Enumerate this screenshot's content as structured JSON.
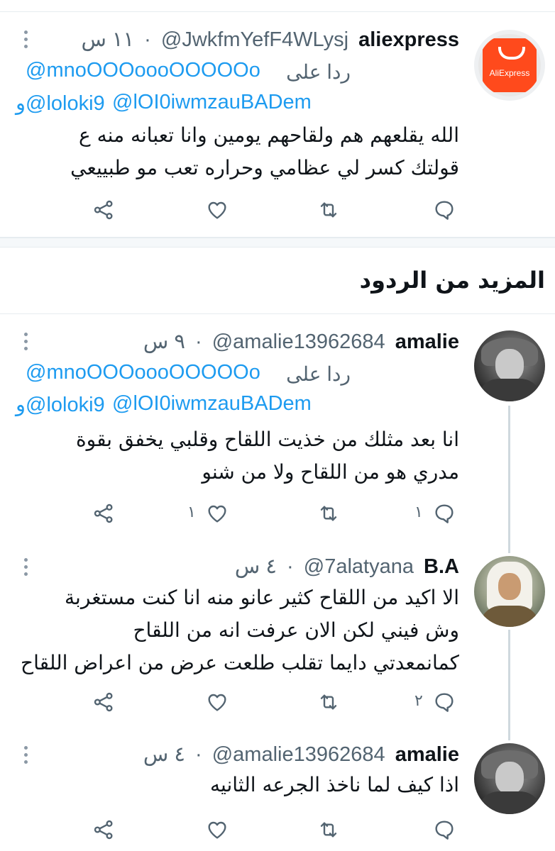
{
  "section_title": "المزيد من الردود",
  "reply_label": "ردا على",
  "colors": {
    "link": "#1d9bf0",
    "muted": "#536471",
    "text": "#0f1419",
    "divider": "#e6ecf0"
  },
  "tweets": [
    {
      "avatar_label": "AliExpress",
      "name": "aliexpress",
      "handle": "@JwkfmYefF4WLysj",
      "dot": "·",
      "time": "١١ س",
      "mention1": "@mnoOOOoooOOOOOo",
      "mention2": "@lOI0iwmzauBADem",
      "mention3": "و@loloki9",
      "lines": [
        "الله يقلعهم هم ولقاحهم يومين وانا تعبانه منه ع",
        "قولتك كسر لي عظامي وحراره تعب مو طبييعي"
      ],
      "reply_count": "",
      "retweet_count": "",
      "like_count": ""
    },
    {
      "name": "amalie",
      "handle": "@amalie13962684",
      "dot": "·",
      "time": "٩ س",
      "mention1": "@mnoOOOoooOOOOOo",
      "mention2": "@lOI0iwmzauBADem",
      "mention3": "و@loloki9",
      "lines": [
        "انا بعد مثلك من خذيت اللقاح وقلبي يخفق بقوة",
        "مدري هو من اللقاح ولا من شنو"
      ],
      "reply_count": "١",
      "retweet_count": "",
      "like_count": "١"
    },
    {
      "name": "B.A",
      "handle": "@7alatyana",
      "dot": "·",
      "time": "٤ س",
      "lines": [
        "الا اكيد من اللقاح كثير عانو منه انا كنت مستغربة",
        "وش فيني لكن الان عرفت انه من اللقاح",
        "كمانمعدتي دايما تقلب طلعت عرض من اعراض اللقاح"
      ],
      "reply_count": "٢",
      "retweet_count": "",
      "like_count": ""
    },
    {
      "name": "amalie",
      "handle": "@amalie13962684",
      "dot": "·",
      "time": "٤ س",
      "lines": [
        "اذا كيف لما ناخذ الجرعه الثانيه"
      ],
      "reply_count": "",
      "retweet_count": "",
      "like_count": ""
    }
  ]
}
